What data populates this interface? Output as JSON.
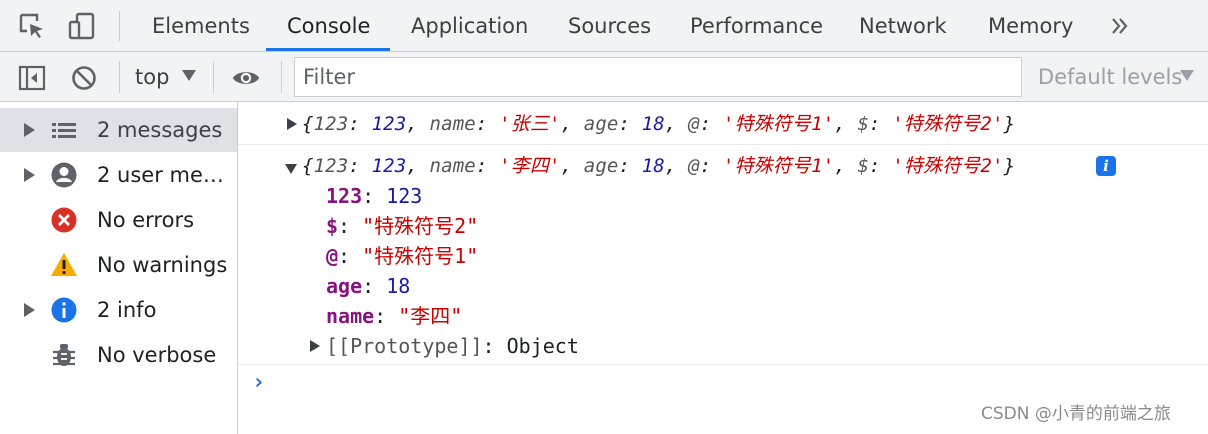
{
  "tabs": [
    {
      "label": "Elements",
      "active": false
    },
    {
      "label": "Console",
      "active": true
    },
    {
      "label": "Application",
      "active": false
    },
    {
      "label": "Sources",
      "active": false
    },
    {
      "label": "Performance",
      "active": false
    },
    {
      "label": "Network",
      "active": false
    },
    {
      "label": "Memory",
      "active": false
    }
  ],
  "toolbar": {
    "context": "top",
    "filter_placeholder": "Filter",
    "levels": "Default levels"
  },
  "sidebar": {
    "items": [
      {
        "label": "2 messages",
        "icon": "list-icon",
        "expandable": true,
        "selected": true
      },
      {
        "label": "2 user mess…",
        "icon": "user-icon",
        "expandable": true,
        "selected": false
      },
      {
        "label": "No errors",
        "icon": "error-icon",
        "expandable": false,
        "selected": false
      },
      {
        "label": "No warnings",
        "icon": "warning-icon",
        "expandable": false,
        "selected": false
      },
      {
        "label": "2 info",
        "icon": "info-icon",
        "expandable": true,
        "selected": false
      },
      {
        "label": "No verbose",
        "icon": "bug-icon",
        "expandable": false,
        "selected": false
      }
    ]
  },
  "console": {
    "log1": {
      "open": "{",
      "k1": "123",
      "v1": "123",
      "k2": "name",
      "v2": "'张三'",
      "k3": "age",
      "v3": "18",
      "k4": "@",
      "v4": "'特殊符号1'",
      "k5": "$",
      "v5": "'特殊符号2'",
      "close": "}"
    },
    "log2": {
      "open": "{",
      "k1": "123",
      "v1": "123",
      "k2": "name",
      "v2": "'李四'",
      "k3": "age",
      "v3": "18",
      "k4": "@",
      "v4": "'特殊符号1'",
      "k5": "$",
      "v5": "'特殊符号2'",
      "close": "}",
      "info_badge": "i",
      "properties": [
        {
          "key": "123",
          "value": "123",
          "type": "number"
        },
        {
          "key": "$",
          "value": "\"特殊符号2\"",
          "type": "string"
        },
        {
          "key": "@",
          "value": "\"特殊符号1\"",
          "type": "string"
        },
        {
          "key": "age",
          "value": "18",
          "type": "number"
        },
        {
          "key": "name",
          "value": "\"李四\"",
          "type": "string"
        }
      ],
      "prototype_key": "[[Prototype]]",
      "prototype_value": "Object"
    },
    "prompt": "›"
  },
  "watermark": "CSDN @小青的前端之旅",
  "colors": {
    "accent": "#1a73e8",
    "error": "#d93025",
    "warning": "#f9ab00",
    "string": "#c80000",
    "number": "#1a1aa6",
    "key": "#881280"
  }
}
